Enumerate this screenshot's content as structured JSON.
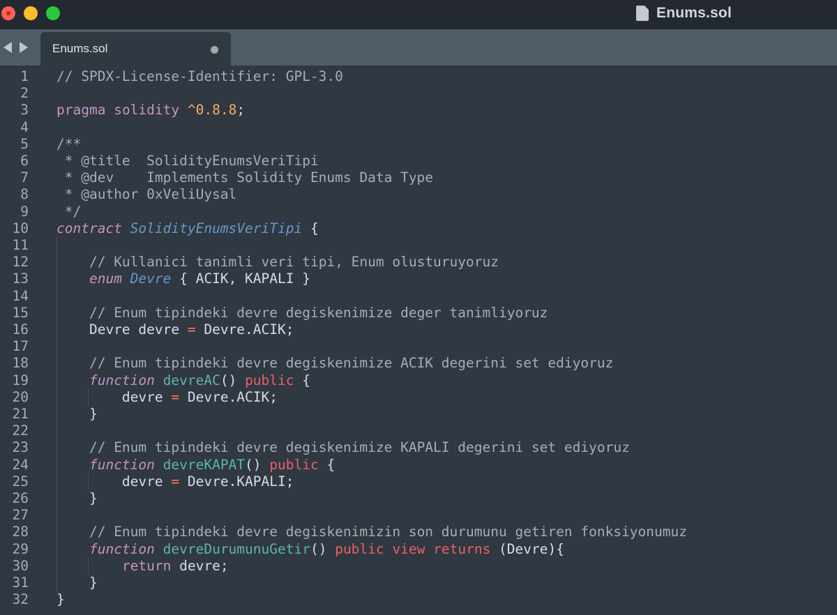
{
  "window": {
    "title": "Enums.sol"
  },
  "tabs": [
    {
      "label": "Enums.sol",
      "modified": true
    }
  ],
  "editor": {
    "line_numbers": [
      "1",
      "2",
      "3",
      "4",
      "5",
      "6",
      "7",
      "8",
      "9",
      "10",
      "11",
      "12",
      "13",
      "14",
      "15",
      "16",
      "17",
      "18",
      "19",
      "20",
      "21",
      "22",
      "23",
      "24",
      "25",
      "26",
      "27",
      "28",
      "29",
      "30",
      "31",
      "32"
    ],
    "lines": [
      [
        [
          "comment",
          "// SPDX-License-Identifier: GPL-3.0"
        ]
      ],
      [],
      [
        [
          "key",
          "pragma"
        ],
        [
          "plain",
          " "
        ],
        [
          "key",
          "solidity"
        ],
        [
          "plain",
          " "
        ],
        [
          "num",
          "^0.8.8"
        ],
        [
          "plain",
          ";"
        ]
      ],
      [],
      [
        [
          "comment",
          "/**"
        ]
      ],
      [
        [
          "comment",
          " * @title  SolidityEnumsVeriTipi"
        ]
      ],
      [
        [
          "comment",
          " * @dev    Implements Solidity Enums Data Type"
        ]
      ],
      [
        [
          "comment",
          " * @author 0xVeliUysal"
        ]
      ],
      [
        [
          "comment",
          " */"
        ]
      ],
      [
        [
          "kwit",
          "contract"
        ],
        [
          "plain",
          " "
        ],
        [
          "cls",
          "SolidityEnumsVeriTipi"
        ],
        [
          "plain",
          " {"
        ]
      ],
      [],
      [
        [
          "plain",
          "    "
        ],
        [
          "comment",
          "// Kullanici tanimli veri tipi, Enum olusturuyoruz"
        ]
      ],
      [
        [
          "plain",
          "    "
        ],
        [
          "kwit",
          "enum"
        ],
        [
          "plain",
          " "
        ],
        [
          "cls",
          "Devre"
        ],
        [
          "plain",
          " { ACIK, KAPALI }"
        ]
      ],
      [],
      [
        [
          "plain",
          "    "
        ],
        [
          "comment",
          "// Enum tipindeki devre degiskenimize deger tanimliyoruz"
        ]
      ],
      [
        [
          "plain",
          "    Devre devre "
        ],
        [
          "op",
          "="
        ],
        [
          "plain",
          " Devre.ACIK;"
        ]
      ],
      [],
      [
        [
          "plain",
          "    "
        ],
        [
          "comment",
          "// Enum tipindeki devre degiskenimize ACIK degerini set ediyoruz"
        ]
      ],
      [
        [
          "plain",
          "    "
        ],
        [
          "kwit",
          "function"
        ],
        [
          "plain",
          " "
        ],
        [
          "fn",
          "devreAC"
        ],
        [
          "plain",
          "() "
        ],
        [
          "red",
          "public"
        ],
        [
          "plain",
          " {"
        ]
      ],
      [
        [
          "plain",
          "        devre "
        ],
        [
          "op",
          "="
        ],
        [
          "plain",
          " Devre.ACIK;"
        ]
      ],
      [
        [
          "plain",
          "    }"
        ]
      ],
      [],
      [
        [
          "plain",
          "    "
        ],
        [
          "comment",
          "// Enum tipindeki devre degiskenimize KAPALI degerini set ediyoruz"
        ]
      ],
      [
        [
          "plain",
          "    "
        ],
        [
          "kwit",
          "function"
        ],
        [
          "plain",
          " "
        ],
        [
          "fn",
          "devreKAPAT"
        ],
        [
          "plain",
          "() "
        ],
        [
          "red",
          "public"
        ],
        [
          "plain",
          " {"
        ]
      ],
      [
        [
          "plain",
          "        devre "
        ],
        [
          "op",
          "="
        ],
        [
          "plain",
          " Devre.KAPALI;"
        ]
      ],
      [
        [
          "plain",
          "    }"
        ]
      ],
      [],
      [
        [
          "plain",
          "    "
        ],
        [
          "comment",
          "// Enum tipindeki devre degiskenimizin son durumunu getiren fonksiyonumuz"
        ]
      ],
      [
        [
          "plain",
          "    "
        ],
        [
          "kwit",
          "function"
        ],
        [
          "plain",
          " "
        ],
        [
          "fn",
          "devreDurumunuGetir"
        ],
        [
          "plain",
          "() "
        ],
        [
          "red",
          "public"
        ],
        [
          "plain",
          " "
        ],
        [
          "red",
          "view"
        ],
        [
          "plain",
          " "
        ],
        [
          "red",
          "returns"
        ],
        [
          "plain",
          " (Devre){"
        ]
      ],
      [
        [
          "plain",
          "        "
        ],
        [
          "key",
          "return"
        ],
        [
          "plain",
          " devre;"
        ]
      ],
      [
        [
          "plain",
          "    }"
        ]
      ],
      [
        [
          "plain",
          "}"
        ]
      ]
    ]
  },
  "colors": {
    "background": "#303841",
    "titlebar": "#24292f",
    "tabbar": "#4f5b66",
    "comment": "#a7adba",
    "keyword": "#c594c5",
    "type": "#5fb3b3",
    "number": "#f9ae58",
    "modifier": "#ec5f67"
  },
  "icons": [
    "close-button",
    "minimize-button",
    "maximize-button",
    "file-icon",
    "back-arrow-icon",
    "forward-arrow-icon",
    "unsaved-dot-icon"
  ]
}
